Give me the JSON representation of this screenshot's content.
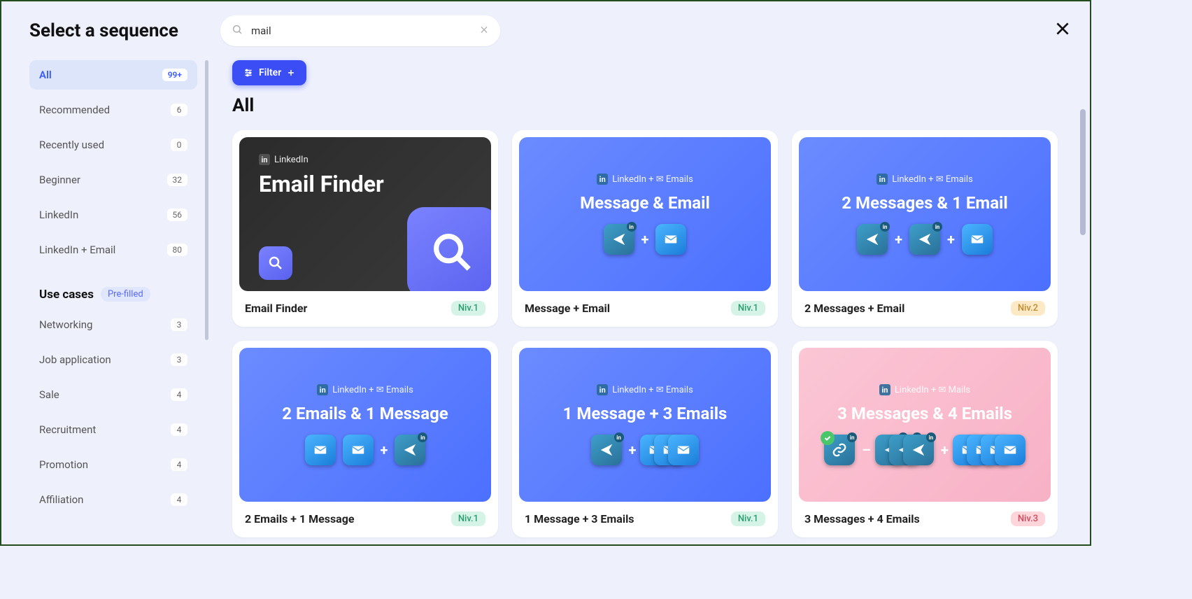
{
  "title": "Select a sequence",
  "search": {
    "value": "mail"
  },
  "filter_label": "Filter",
  "main_heading": "All",
  "categories": [
    {
      "label": "All",
      "count": "99+",
      "active": true
    },
    {
      "label": "Recommended",
      "count": "6"
    },
    {
      "label": "Recently used",
      "count": "0"
    },
    {
      "label": "Beginner",
      "count": "32"
    },
    {
      "label": "LinkedIn",
      "count": "56"
    },
    {
      "label": "LinkedIn + Email",
      "count": "80"
    }
  ],
  "use_cases_heading": "Use cases",
  "prefilled_label": "Pre-filled",
  "use_cases": [
    {
      "label": "Networking",
      "count": "3"
    },
    {
      "label": "Job application",
      "count": "3"
    },
    {
      "label": "Sale",
      "count": "4"
    },
    {
      "label": "Recruitment",
      "count": "4"
    },
    {
      "label": "Promotion",
      "count": "4"
    },
    {
      "label": "Affiliation",
      "count": "4"
    }
  ],
  "cards": [
    {
      "tag": "LinkedIn",
      "img_title": "Email Finder",
      "title": "Email Finder",
      "niv": "Niv.1",
      "niv_cls": "n1",
      "style": "dark"
    },
    {
      "tag": "LinkedIn + ✉ Emails",
      "img_title": "Message & Email",
      "title": "Message + Email",
      "niv": "Niv.1",
      "niv_cls": "n1",
      "style": "blue"
    },
    {
      "tag": "LinkedIn + ✉ Emails",
      "img_title": "2 Messages & 1 Email",
      "title": "2 Messages + Email",
      "niv": "Niv.2",
      "niv_cls": "n2",
      "style": "blue"
    },
    {
      "tag": "LinkedIn + ✉ Emails",
      "img_title": "2 Emails & 1 Message",
      "title": "2 Emails + 1 Message",
      "niv": "Niv.1",
      "niv_cls": "n1",
      "style": "blue"
    },
    {
      "tag": "LinkedIn + ✉ Emails",
      "img_title": "1 Message + 3 Emails",
      "title": "1 Message + 3 Emails",
      "niv": "Niv.1",
      "niv_cls": "n1",
      "style": "blue"
    },
    {
      "tag": "LinkedIn + ✉ Mails",
      "img_title": "3 Messages & 4 Emails",
      "title": "3 Messages + 4 Emails",
      "niv": "Niv.3",
      "niv_cls": "n3",
      "style": "pink"
    }
  ]
}
